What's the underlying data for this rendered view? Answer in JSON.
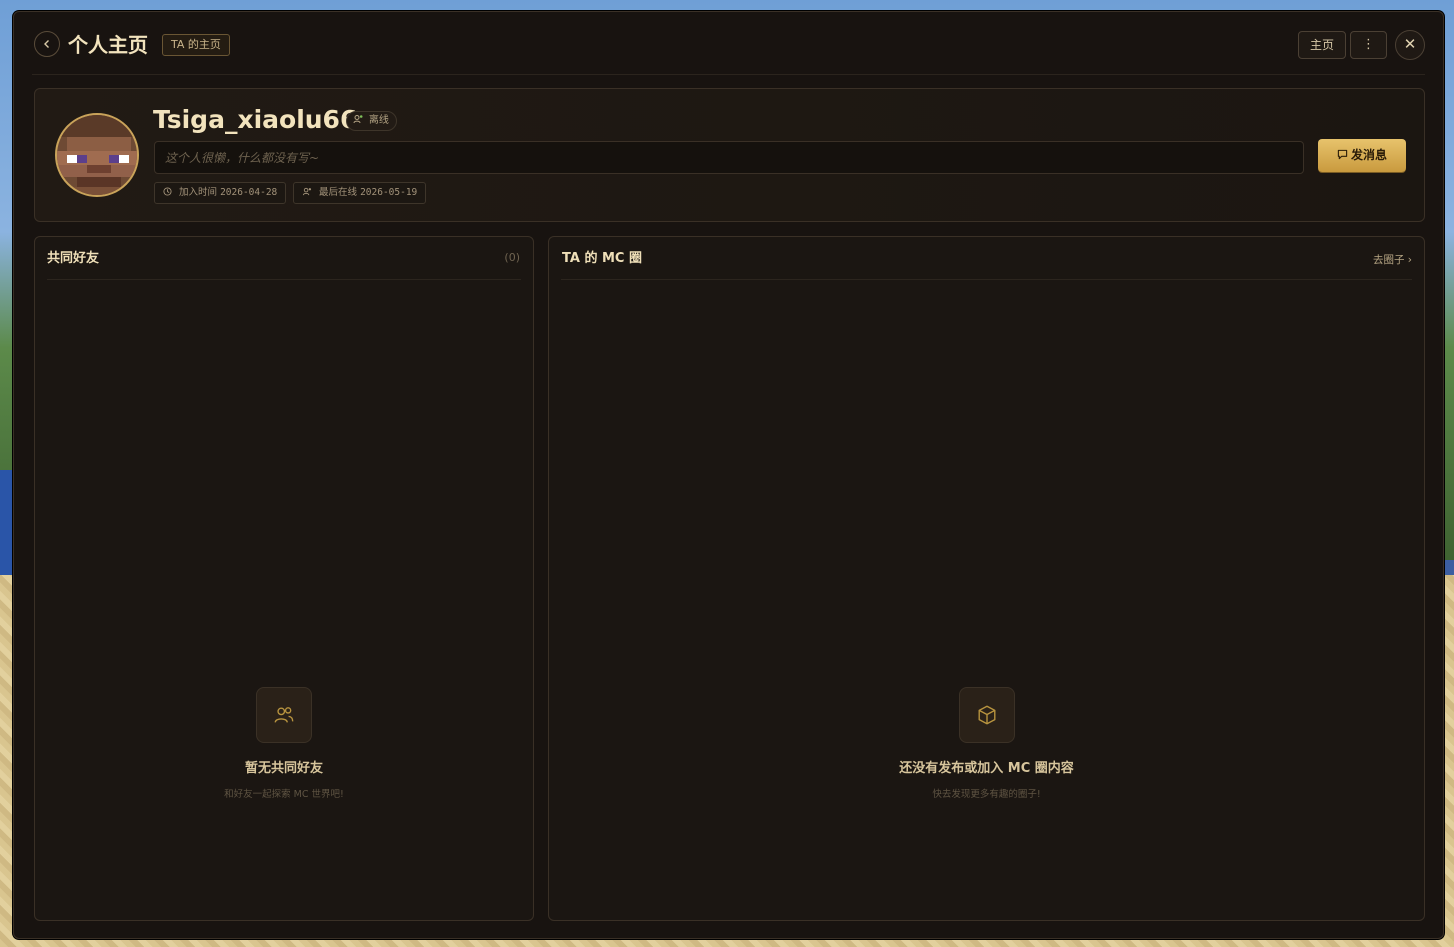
{
  "header": {
    "back_icon": "chevron-left-icon",
    "title": "个人主页",
    "tag": "TA 的主页",
    "home_label": "主页",
    "more_label": "⋮",
    "close_label": "✕"
  },
  "profile": {
    "username": "Tsiga_xiaolu66",
    "status": "离线",
    "bio_placeholder": "这个人很懒，什么都没有写~",
    "message_button": "发消息",
    "joined_label": "加入时间",
    "joined_date": "2026-04-28",
    "last_online_label": "最后在线",
    "last_online_date": "2026-05-19"
  },
  "friends_panel": {
    "title": "共同好友",
    "count": "(0)",
    "empty_title": "暂无共同好友",
    "empty_sub": "和好友一起探索 MC 世界吧!"
  },
  "mc_panel": {
    "title": "TA 的 MC 圈",
    "link": "去圈子 ›",
    "empty_title": "还没有发布或加入 MC 圈内容",
    "empty_sub": "快去发现更多有趣的圈子!"
  },
  "colors": {
    "accent": "#e7c36c",
    "window_bg": "#181310",
    "title_text": "#f2e3bd"
  }
}
